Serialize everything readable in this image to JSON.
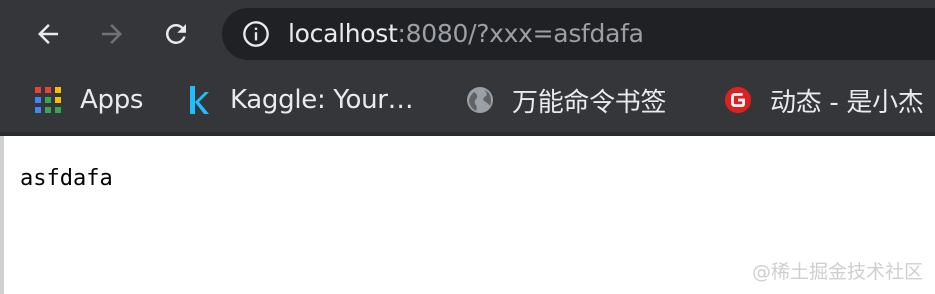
{
  "address_bar": {
    "url_host": "localhost",
    "url_rest": ":8080/?xxx=asfdafa"
  },
  "bookmarks": [
    {
      "label": "Apps",
      "icon": "apps-grid-icon"
    },
    {
      "label": "Kaggle: Your…",
      "icon": "kaggle-k-icon"
    },
    {
      "label": "万能命令书签",
      "icon": "globe-icon"
    },
    {
      "label": "动态 - 是小杰",
      "icon": "g-logo-icon"
    }
  ],
  "page": {
    "body_text": "asfdafa",
    "watermark": "@稀土掘金技术社区"
  },
  "colors": {
    "chrome_bg": "#35363a",
    "omnibox_bg": "#202124",
    "text_primary": "#e8eaed",
    "text_secondary": "#9aa0a6",
    "kaggle_blue": "#20beff",
    "g_logo_red": "#e02020"
  }
}
